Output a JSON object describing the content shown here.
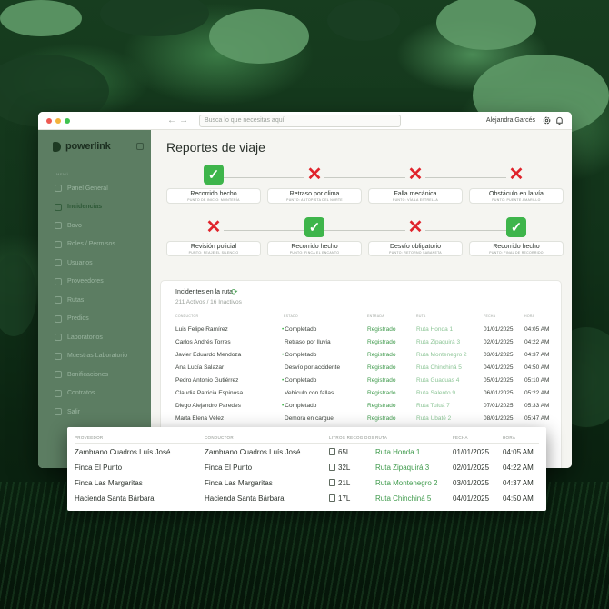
{
  "window": {
    "search_placeholder": "Busca lo que necesitas aquí",
    "user_name": "Alejandra Garcés"
  },
  "sidebar": {
    "brand": "powerlink",
    "section": "MENÚ",
    "items": [
      {
        "label": "Panel General",
        "icon": "dashboard-icon",
        "active": false
      },
      {
        "label": "Incidencias",
        "icon": "alert-icon",
        "active": true
      },
      {
        "label": "Bovo",
        "icon": "cow-icon",
        "active": false
      },
      {
        "label": "Roles / Permisos",
        "icon": "shield-icon",
        "active": false
      },
      {
        "label": "Usuarios",
        "icon": "users-icon",
        "active": false
      },
      {
        "label": "Proveedores",
        "icon": "truck-icon",
        "active": false
      },
      {
        "label": "Rutas",
        "icon": "route-icon",
        "active": false
      },
      {
        "label": "Predios",
        "icon": "map-icon",
        "active": false
      },
      {
        "label": "Laboratorios",
        "icon": "flask-icon",
        "active": false
      },
      {
        "label": "Muestras Laboratorio",
        "icon": "test-tube-icon",
        "active": false
      },
      {
        "label": "Bonificaciones",
        "icon": "gift-icon",
        "active": false
      },
      {
        "label": "Contratos",
        "icon": "document-icon",
        "active": false
      },
      {
        "label": "Salir",
        "icon": "logout-icon",
        "active": false
      }
    ]
  },
  "main": {
    "title": "Reportes de viaje",
    "steps_row1": [
      {
        "status": "ok",
        "label": "Recorrido hecho",
        "sub": "PUNTO DE INICIO: MONTERÍA"
      },
      {
        "status": "bad",
        "label": "Retraso por clima",
        "sub": "PUNTO: AUTOPISTA DEL NORTE"
      },
      {
        "status": "bad",
        "label": "Falla mecánica",
        "sub": "PUNTO: VÍA LA ESTRELLA"
      },
      {
        "status": "bad",
        "label": "Obstáculo en la vía",
        "sub": "PUNTO: PUENTE AMARILLO"
      }
    ],
    "steps_row2": [
      {
        "status": "bad",
        "label": "Revisión policial",
        "sub": "PUNTO: PEAJE EL SILENCIO"
      },
      {
        "status": "ok",
        "label": "Recorrido hecho",
        "sub": "PUNTO: FINCA EL ENCANTO"
      },
      {
        "status": "bad",
        "label": "Desvío obligatorio",
        "sub": "PUNTO: RETORNO SABANETA"
      },
      {
        "status": "ok",
        "label": "Recorrido hecho",
        "sub": "PUNTO: FINAL DE RECORRIDO"
      }
    ],
    "incidents": {
      "title": "Incidentes en la ruta",
      "subtitle": "211 Activos / 16 Inactivos",
      "headers": {
        "driver": "CONDUCTOR",
        "status": "ESTADO",
        "record": "ENTRADA",
        "route": "RUTA",
        "date": "FECHA",
        "time": "HORA"
      },
      "rows": [
        {
          "driver": "Luis Felipe Ramírez",
          "status": "Completado",
          "record": "Registrado",
          "route": "Ruta Honda 1",
          "date": "01/01/2025",
          "time": "04:05 AM"
        },
        {
          "driver": "Carlos Andrés Torres",
          "status": "Retraso por lluvia",
          "record": "Registrado",
          "route": "Ruta Zipaquirá 3",
          "date": "02/01/2025",
          "time": "04:22 AM"
        },
        {
          "driver": "Javier Eduardo Mendoza",
          "status": "Completado",
          "record": "Registrado",
          "route": "Ruta Montenegro 2",
          "date": "03/01/2025",
          "time": "04:37 AM"
        },
        {
          "driver": "Ana Lucía Salazar",
          "status": "Desvío por accidente",
          "record": "Registrado",
          "route": "Ruta Chinchiná 5",
          "date": "04/01/2025",
          "time": "04:50 AM"
        },
        {
          "driver": "Pedro Antonio Gutiérrez",
          "status": "Completado",
          "record": "Registrado",
          "route": "Ruta Guaduas 4",
          "date": "05/01/2025",
          "time": "05:10 AM"
        },
        {
          "driver": "Claudia Patricia Espinosa",
          "status": "Vehículo con fallas",
          "record": "Registrado",
          "route": "Ruta Salento 9",
          "date": "06/01/2025",
          "time": "05:22 AM"
        },
        {
          "driver": "Diego Alejandro Paredes",
          "status": "Completado",
          "record": "Registrado",
          "route": "Ruta Tuluá 7",
          "date": "07/01/2025",
          "time": "05:33 AM"
        },
        {
          "driver": "Marta Elena Vélez",
          "status": "Demora en cargue",
          "record": "Registrado",
          "route": "Ruta Ubaté 2",
          "date": "08/01/2025",
          "time": "05:47 AM"
        }
      ]
    }
  },
  "float_table": {
    "headers": {
      "provider": "PROVEEDOR",
      "driver": "CONDUCTOR",
      "liters": "LITROS RECOGIDOS",
      "route": "RUTA",
      "date": "FECHA",
      "time": "HORA"
    },
    "rows": [
      {
        "provider": "Zambrano Cuadros Luís José",
        "driver": "Zambrano Cuadros Luís José",
        "liters": "65L",
        "route": "Ruta Honda 1",
        "date": "01/01/2025",
        "time": "04:05 AM"
      },
      {
        "provider": "Finca El Punto",
        "driver": "Finca El Punto",
        "liters": "32L",
        "route": "Ruta Zipaquirá 3",
        "date": "02/01/2025",
        "time": "04:22 AM"
      },
      {
        "provider": "Finca Las Margaritas",
        "driver": "Finca Las Margaritas",
        "liters": "21L",
        "route": "Ruta Montenegro 2",
        "date": "03/01/2025",
        "time": "04:37 AM"
      },
      {
        "provider": "Hacienda Santa Bárbara",
        "driver": "Hacienda Santa Bárbara",
        "liters": "17L",
        "route": "Ruta Chinchiná 5",
        "date": "04/01/2025",
        "time": "04:50 AM"
      }
    ]
  },
  "colors": {
    "accent": "#3e9a4b",
    "error": "#e0242c",
    "sidebar": "#5c7d62"
  }
}
